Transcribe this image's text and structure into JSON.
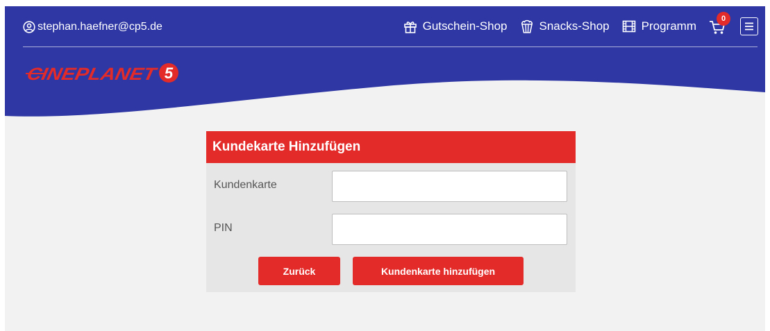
{
  "header": {
    "user_email": "stephan.haefner@cp5.de",
    "nav": [
      {
        "label": "Gutschein-Shop",
        "icon": "gift-icon"
      },
      {
        "label": "Snacks-Shop",
        "icon": "popcorn-icon"
      },
      {
        "label": "Programm",
        "icon": "film-icon"
      }
    ],
    "cart_count": "0",
    "logo_text": "CINEPLANET",
    "logo_number": "5"
  },
  "form": {
    "title": "Kundekarte Hinzufügen",
    "card_label": "Kundenkarte",
    "card_value": "",
    "pin_label": "PIN",
    "pin_value": "",
    "back_button": "Zurück",
    "submit_button": "Kundenkarte hinzufügen"
  },
  "colors": {
    "header_blue": "#2e37a4",
    "accent_red": "#e32b29",
    "page_bg": "#f2f2f2",
    "panel_bg": "#e6e6e6"
  }
}
